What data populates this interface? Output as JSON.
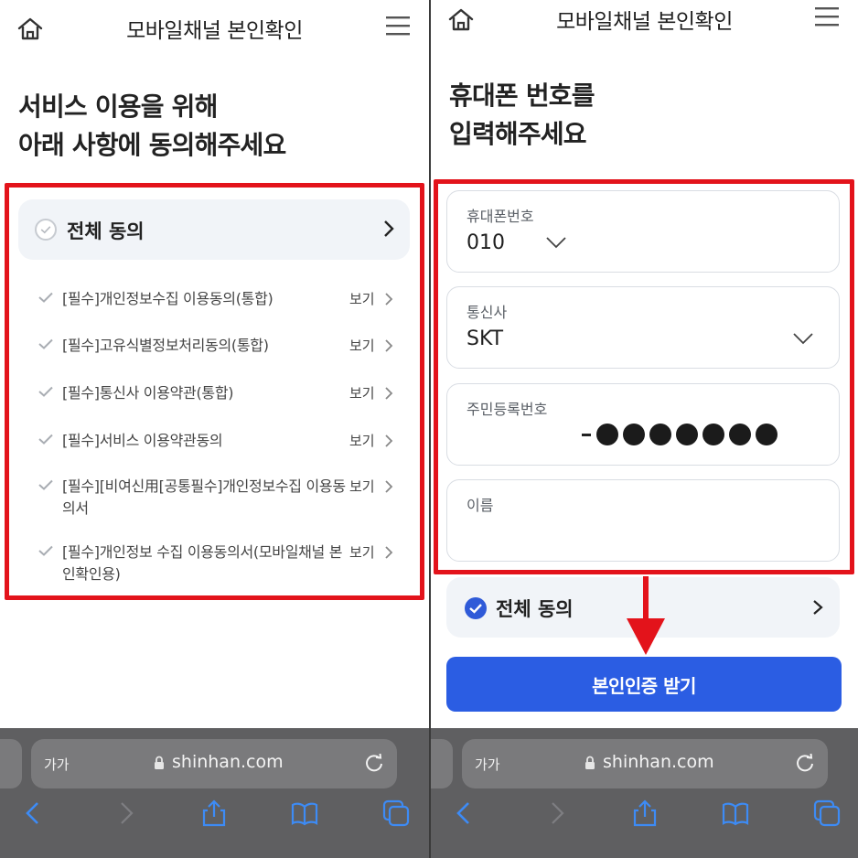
{
  "header": {
    "title": "모바일채널 본인확인"
  },
  "left": {
    "heading_line1": "서비스 이용을 위해",
    "heading_line2": "아래 사항에 동의해주세요",
    "agree_all": "전체 동의",
    "terms": [
      {
        "label": "[필수]개인정보수집 이용동의(통합)",
        "view": "보기"
      },
      {
        "label": "[필수]고유식별정보처리동의(통합)",
        "view": "보기"
      },
      {
        "label": "[필수]통신사 이용약관(통합)",
        "view": "보기"
      },
      {
        "label": "[필수]서비스 이용약관동의",
        "view": "보기"
      },
      {
        "label": "[필수][비여신用[공통필수]개인정보수집 이용동의서",
        "view": "보기"
      },
      {
        "label": "[필수]개인정보 수집 이용동의서(모바일채널 본인확인용)",
        "view": "보기"
      }
    ]
  },
  "right": {
    "heading_line1": "휴대폰 번호를",
    "heading_line2": "입력해주세요",
    "phone": {
      "label": "휴대폰번호",
      "value": "010"
    },
    "carrier": {
      "label": "통신사",
      "value": "SKT"
    },
    "rrn": {
      "label": "주민등록번호",
      "masked_digits": 7
    },
    "name": {
      "label": "이름",
      "value": ""
    },
    "agree_all": "전체 동의",
    "agree_checked": true,
    "cta": "본인인증 받기"
  },
  "browser": {
    "aa": "가가",
    "host": "shinhan.com"
  },
  "colors": {
    "highlight": "#e3131b",
    "primary": "#2b5de3",
    "toolbar": "#5f5f61",
    "ios_blue": "#3d8bf5"
  }
}
